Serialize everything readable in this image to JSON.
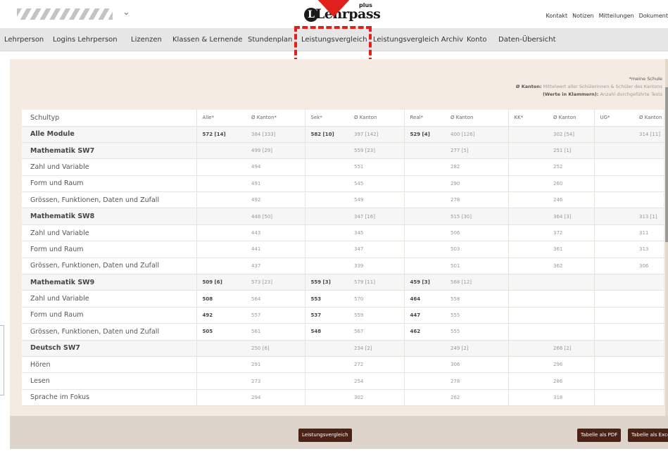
{
  "header": {
    "brand": "Lehrpass",
    "brand_plus": "plus",
    "links": [
      "Kontakt",
      "Notizen",
      "Mitteilungen",
      "Dokument"
    ]
  },
  "nav": {
    "items": [
      "Lehrperson",
      "Logins Lehrperson",
      "Lizenzen",
      "Klassen & Lernende",
      "Stundenplan",
      "Leistungsvergleich",
      "Leistungsvergleich Archiv",
      "Konto",
      "Daten-Übersicht"
    ],
    "active": "Leistungsvergleich"
  },
  "legend": {
    "line1": "*meine Schule",
    "line2_label": "Ø Kanton:",
    "line2_text": "Mittelwert aller Schülerinnen & Schüler des Kantons",
    "line3_label": "(Werte in Klammern):",
    "line3_text": "Anzahl durchgeführte Tests"
  },
  "table": {
    "headers": [
      "Schultyp",
      "Alle*",
      "Ø Kanton*",
      "Sek*",
      "Ø Kanton",
      "Real*",
      "Ø Kanton",
      "KK*",
      "Ø Kanton",
      "UG*",
      "Ø Kanton"
    ],
    "rows": [
      {
        "name": "Alle Module",
        "group": true,
        "cells": [
          "572 [14]",
          "384 [333]",
          "582 [10]",
          "397 [142]",
          "529 [4]",
          "400 [126]",
          "",
          "302 [54]",
          "",
          "314 [11]"
        ]
      },
      {
        "name": "Mathematik SW7",
        "group": true,
        "cells": [
          "",
          "499 [29]",
          "",
          "559 [23]",
          "",
          "277 [5]",
          "",
          "251 [1]",
          "",
          ""
        ]
      },
      {
        "name": "Zahl und Variable",
        "group": false,
        "cells": [
          "",
          "494",
          "",
          "551",
          "",
          "282",
          "",
          "252",
          "",
          ""
        ]
      },
      {
        "name": "Form und Raum",
        "group": false,
        "cells": [
          "",
          "491",
          "",
          "545",
          "",
          "290",
          "",
          "260",
          "",
          ""
        ]
      },
      {
        "name": "Grössen, Funktionen, Daten und Zufall",
        "group": false,
        "cells": [
          "",
          "492",
          "",
          "549",
          "",
          "278",
          "",
          "246",
          "",
          ""
        ]
      },
      {
        "name": "Mathematik SW8",
        "group": true,
        "cells": [
          "",
          "448 [50]",
          "",
          "347 [16]",
          "",
          "515 [30]",
          "",
          "364 [3]",
          "",
          "313 [1]"
        ]
      },
      {
        "name": "Zahl und Variable",
        "group": false,
        "cells": [
          "",
          "443",
          "",
          "345",
          "",
          "506",
          "",
          "372",
          "",
          "311"
        ]
      },
      {
        "name": "Form und Raum",
        "group": false,
        "cells": [
          "",
          "441",
          "",
          "347",
          "",
          "503",
          "",
          "361",
          "",
          "313"
        ]
      },
      {
        "name": "Grössen, Funktionen, Daten und Zufall",
        "group": false,
        "cells": [
          "",
          "437",
          "",
          "339",
          "",
          "501",
          "",
          "362",
          "",
          "306"
        ]
      },
      {
        "name": "Mathematik SW9",
        "group": true,
        "cells": [
          "509 [6]",
          "573 [23]",
          "559 [3]",
          "579 [11]",
          "459 [3]",
          "568 [12]",
          "",
          "",
          "",
          ""
        ]
      },
      {
        "name": "Zahl und Variable",
        "group": false,
        "cells": [
          "508",
          "564",
          "553",
          "570",
          "464",
          "558",
          "",
          "",
          "",
          ""
        ]
      },
      {
        "name": "Form und Raum",
        "group": false,
        "cells": [
          "492",
          "557",
          "537",
          "559",
          "447",
          "555",
          "",
          "",
          "",
          ""
        ]
      },
      {
        "name": "Grössen, Funktionen, Daten und Zufall",
        "group": false,
        "cells": [
          "505",
          "561",
          "548",
          "567",
          "462",
          "555",
          "",
          "",
          "",
          ""
        ]
      },
      {
        "name": "Deutsch SW7",
        "group": true,
        "cells": [
          "",
          "250 [6]",
          "",
          "234 [2]",
          "",
          "249 [2]",
          "",
          "266 [2]",
          "",
          ""
        ]
      },
      {
        "name": "Hören",
        "group": false,
        "cells": [
          "",
          "291",
          "",
          "272",
          "",
          "306",
          "",
          "296",
          "",
          ""
        ]
      },
      {
        "name": "Lesen",
        "group": false,
        "cells": [
          "",
          "273",
          "",
          "254",
          "",
          "278",
          "",
          "286",
          "",
          ""
        ]
      },
      {
        "name": "Sprache im Fokus",
        "group": false,
        "cells": [
          "",
          "294",
          "",
          "302",
          "",
          "262",
          "",
          "318",
          "",
          ""
        ]
      }
    ]
  },
  "footer": {
    "center_button": "Leistungsvergleich",
    "pdf_button": "Tabelle als PDF",
    "excel_button": "Tabelle als Exce"
  },
  "colors": {
    "accent_red": "#e0201a",
    "button_brown": "#4a2316",
    "content_bg": "#f4ece3"
  }
}
